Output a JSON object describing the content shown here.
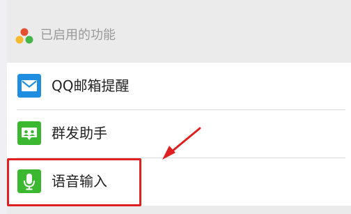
{
  "section": {
    "title": "已启用的功能",
    "icon": "colored-dots-icon"
  },
  "rows": [
    {
      "label": "QQ邮箱提醒",
      "icon": "mail-envelope-icon",
      "color": "#1f8ee0"
    },
    {
      "label": "群发助手",
      "icon": "group-send-icon",
      "color": "#3cb830"
    },
    {
      "label": "语音输入",
      "icon": "microphone-icon",
      "color": "#3cb830"
    }
  ],
  "annotation": {
    "highlight_color": "#e02020"
  }
}
